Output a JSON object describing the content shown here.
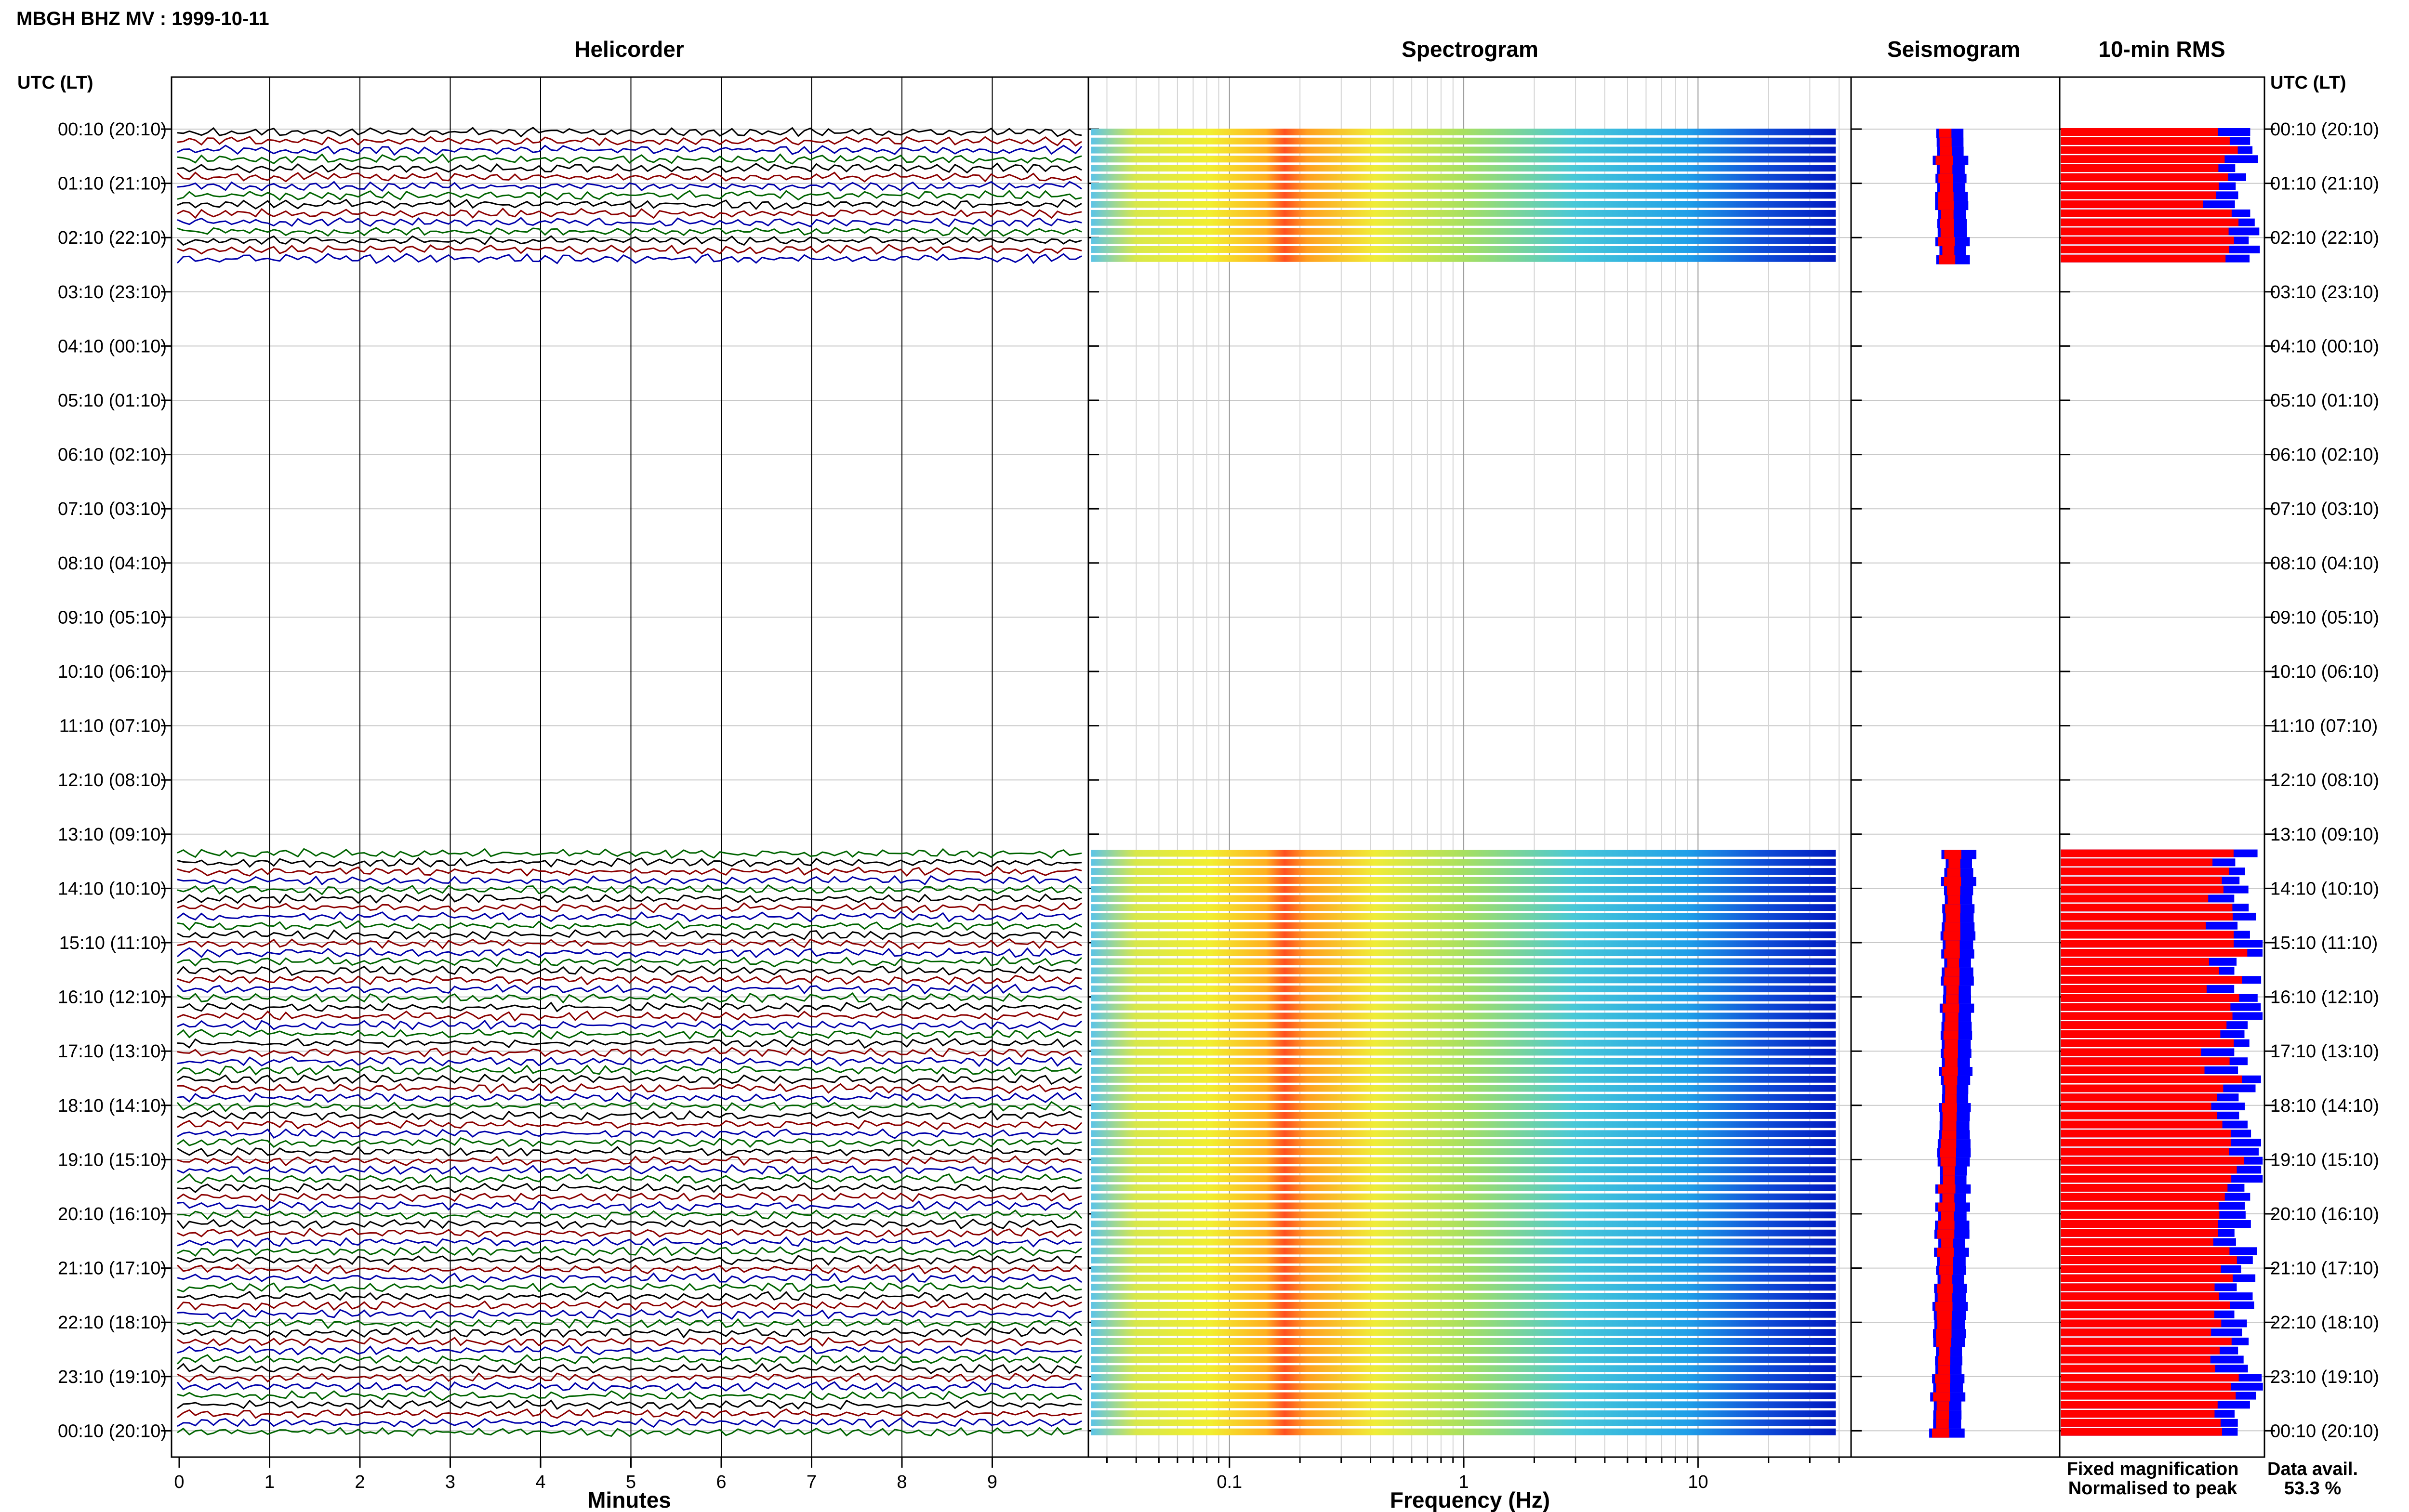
{
  "header": {
    "title": "MBGH BHZ MV : 1999-10-11"
  },
  "panels": {
    "helicorder": "Helicorder",
    "spectrogram": "Spectrogram",
    "seismogram": "Seismogram",
    "rms": "10-min RMS"
  },
  "axes": {
    "left_label": "UTC (LT)",
    "right_label": "UTC (LT)",
    "helicorder_xlabel": "Minutes",
    "spectrogram_xlabel": "Frequency (Hz)"
  },
  "legend": {
    "fixed": "Fixed magnification",
    "normalised": "Normalised to peak",
    "fixed_color": "#0000ff",
    "normalised_color": "#ff0000"
  },
  "data_avail": {
    "label": "Data avail.",
    "value": "53.3 %"
  },
  "colors": {
    "trace_cycle": [
      "#000000",
      "#8b0000",
      "#0000aa",
      "#006400"
    ]
  },
  "chart_data": {
    "type": "helicorder",
    "hour_labels": [
      "00:10 (20:10)",
      "01:10 (21:10)",
      "02:10 (22:10)",
      "03:10 (23:10)",
      "04:10 (00:10)",
      "05:10 (01:10)",
      "06:10 (02:10)",
      "07:10 (03:10)",
      "08:10 (04:10)",
      "09:10 (05:10)",
      "10:10 (06:10)",
      "11:10 (07:10)",
      "12:10 (08:10)",
      "13:10 (09:10)",
      "14:10 (10:10)",
      "15:10 (11:10)",
      "16:10 (12:10)",
      "17:10 (13:10)",
      "18:10 (14:10)",
      "19:10 (15:10)",
      "20:10 (16:10)",
      "21:10 (17:10)",
      "22:10 (18:10)",
      "23:10 (19:10)",
      "00:10 (20:10)"
    ],
    "minutes_ticks": [
      "0",
      "1",
      "2",
      "3",
      "4",
      "5",
      "6",
      "7",
      "8",
      "9"
    ],
    "frequency_ticks": [
      "0.1",
      "1",
      "10"
    ],
    "frequency_range_hz": [
      0.025,
      45
    ],
    "data_segments_hours": [
      [
        0,
        2.4
      ],
      [
        13.3,
        24
      ]
    ],
    "data_availability_percent": 53.3
  }
}
